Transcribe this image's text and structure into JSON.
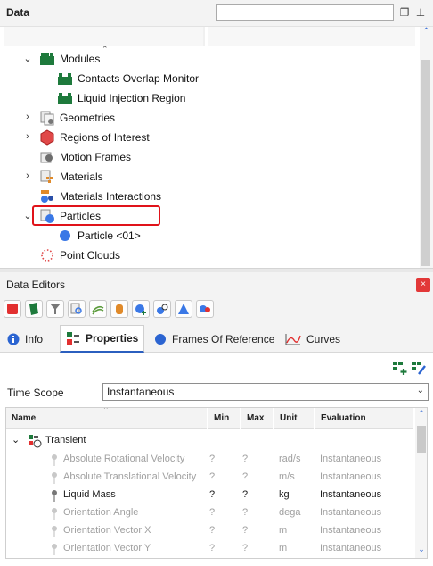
{
  "data_panel": {
    "title": "Data",
    "search_placeholder": "",
    "tree": [
      {
        "label": "Modules",
        "icon": "modules-icon",
        "expanded": true
      },
      {
        "label": "Contacts Overlap Monitor",
        "icon": "module-item-icon"
      },
      {
        "label": "Liquid Injection Region",
        "icon": "module-item-icon"
      },
      {
        "label": "Geometries",
        "icon": "geometries-icon",
        "expanded": false
      },
      {
        "label": "Regions of Interest",
        "icon": "regions-icon",
        "expanded": false
      },
      {
        "label": "Motion Frames",
        "icon": "motion-frames-icon"
      },
      {
        "label": "Materials",
        "icon": "materials-icon",
        "expanded": false
      },
      {
        "label": "Materials Interactions",
        "icon": "materials-interactions-icon"
      },
      {
        "label": "Particles",
        "icon": "particles-icon",
        "expanded": true
      },
      {
        "label": "Particle <01>",
        "icon": "particle-sphere-icon"
      },
      {
        "label": "Point Clouds",
        "icon": "point-clouds-icon"
      }
    ]
  },
  "editors": {
    "title": "Data Editors",
    "close_glyph": "×",
    "tabs": [
      {
        "label": "Info",
        "icon": "info-icon"
      },
      {
        "label": "Properties",
        "icon": "properties-icon",
        "active": true
      },
      {
        "label": "Frames Of Reference",
        "icon": "frames-of-reference-icon"
      },
      {
        "label": "Curves",
        "icon": "curves-icon"
      }
    ],
    "time_scope_label": "Time Scope",
    "time_scope_value": "Instantaneous",
    "columns": [
      "Name",
      "Min",
      "Max",
      "Unit",
      "Evaluation"
    ],
    "group_label": "Transient",
    "rows": [
      {
        "name": "Absolute Rotational Velocity",
        "min": "?",
        "max": "?",
        "unit": "rad/s",
        "evaluation": "Instantaneous",
        "enabled": false
      },
      {
        "name": "Absolute Translational Velocity",
        "min": "?",
        "max": "?",
        "unit": "m/s",
        "evaluation": "Instantaneous",
        "enabled": false
      },
      {
        "name": "Liquid Mass",
        "min": "?",
        "max": "?",
        "unit": "kg",
        "evaluation": "Instantaneous",
        "enabled": true
      },
      {
        "name": "Orientation Angle",
        "min": "?",
        "max": "?",
        "unit": "dega",
        "evaluation": "Instantaneous",
        "enabled": false
      },
      {
        "name": "Orientation Vector X",
        "min": "?",
        "max": "?",
        "unit": "m",
        "evaluation": "Instantaneous",
        "enabled": false
      },
      {
        "name": "Orientation Vector Y",
        "min": "?",
        "max": "?",
        "unit": "m",
        "evaluation": "Instantaneous",
        "enabled": false
      }
    ]
  },
  "colors": {
    "highlight": "#e0131a",
    "module_green": "#1e7a3c",
    "particle_blue": "#3a78e6",
    "tab_accent": "#2b5fbf"
  }
}
